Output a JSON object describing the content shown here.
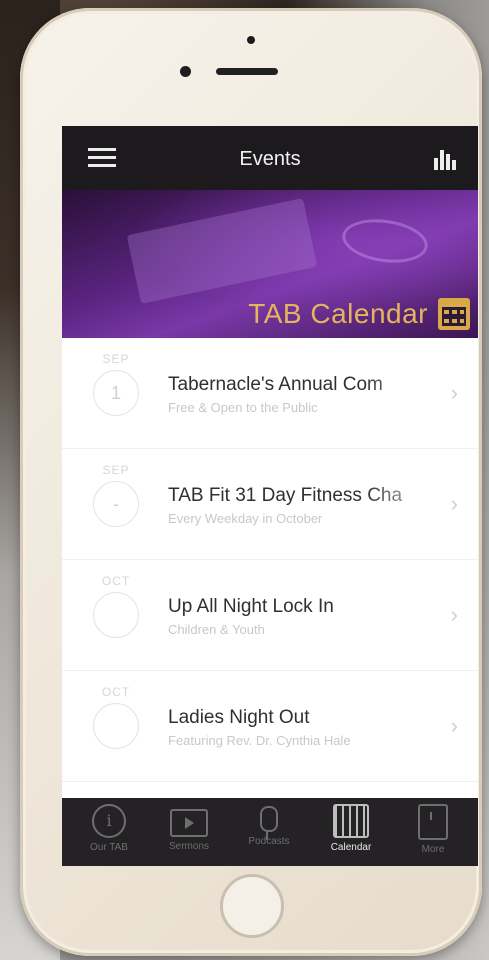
{
  "header": {
    "title": "Events"
  },
  "banner": {
    "title": "TAB Calendar"
  },
  "events": [
    {
      "month": "SEP",
      "day": "1",
      "title": "Tabernacle's Annual Com",
      "subtitle": "Free & Open to the Public"
    },
    {
      "month": "SEP",
      "day": "-",
      "title": "TAB Fit 31 Day Fitness Cha",
      "subtitle": "Every Weekday in October"
    },
    {
      "month": "OCT",
      "day": "",
      "title": "Up All Night Lock In",
      "subtitle": "Children & Youth"
    },
    {
      "month": "OCT",
      "day": "",
      "title": "Ladies Night Out",
      "subtitle": "Featuring Rev. Dr. Cynthia Hale"
    }
  ],
  "tabs": [
    {
      "label": "Our TAB",
      "icon": "info-icon"
    },
    {
      "label": "Sermons",
      "icon": "video-icon"
    },
    {
      "label": "Podcasts",
      "icon": "microphone-icon"
    },
    {
      "label": "Calendar",
      "icon": "calendar-icon",
      "active": true
    },
    {
      "label": "More",
      "icon": "more-icon"
    }
  ],
  "colors": {
    "navbar": "#1c1a1d",
    "accent": "#d9a948",
    "banner_purple": "#5a2480",
    "tabbar": "#242225"
  }
}
